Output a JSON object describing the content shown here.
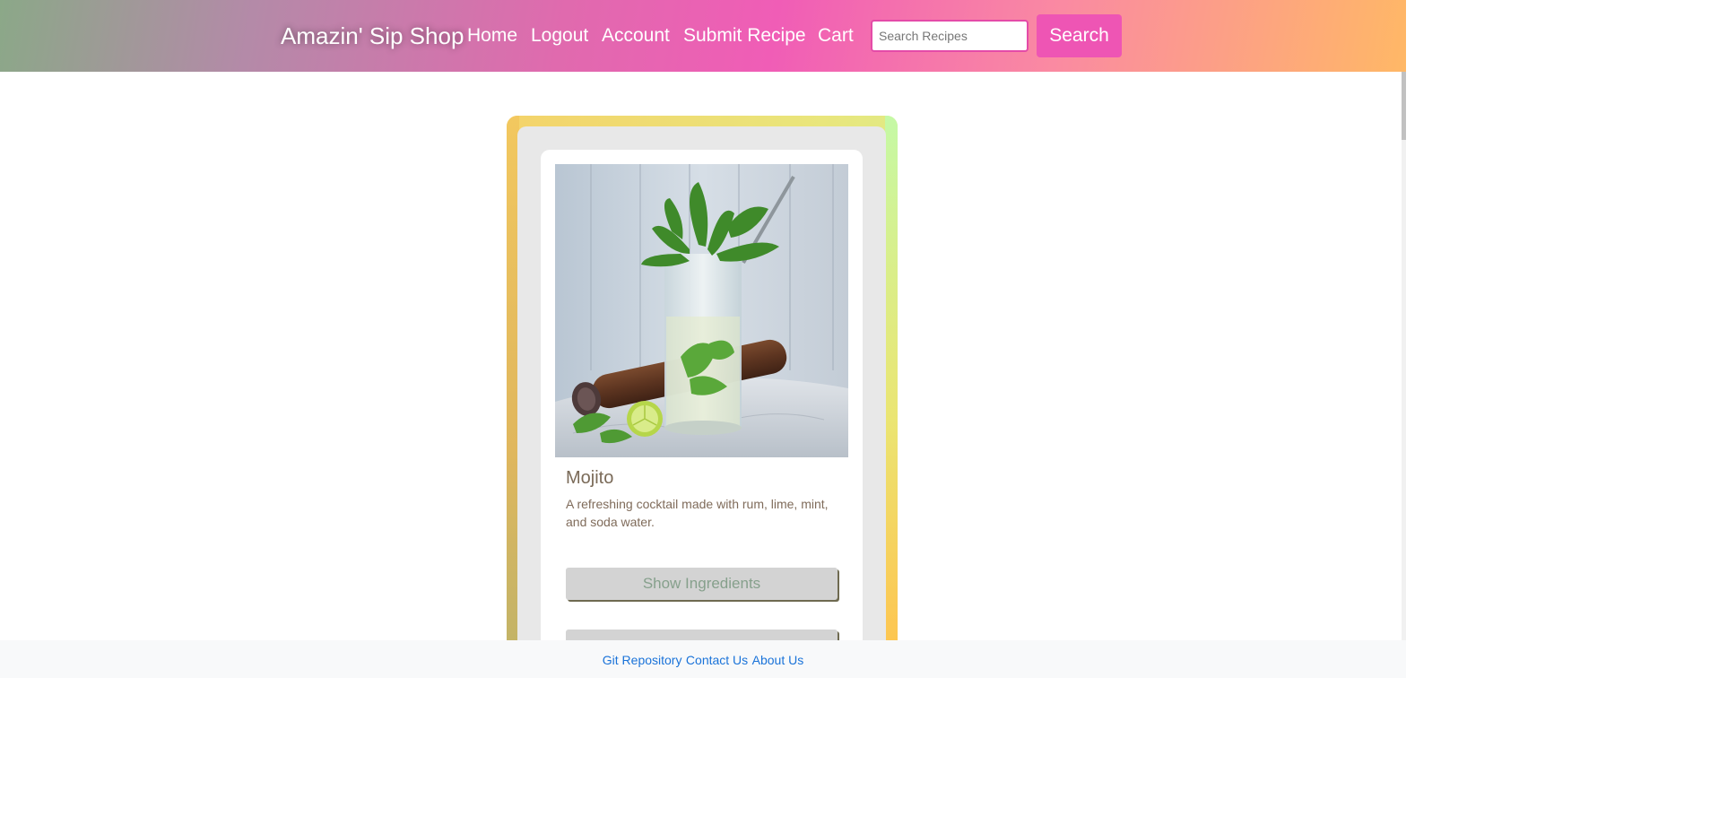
{
  "nav": {
    "brand": "Amazin' Sip Shop",
    "links": [
      "Home",
      "Logout",
      "Account",
      "Submit Recipe",
      "Cart"
    ],
    "search_placeholder": "Search Recipes",
    "search_button": "Search"
  },
  "recipe": {
    "title": "Mojito",
    "description": "A refreshing cocktail made with rum, lime, mint, and soda water.",
    "show_ingredients_label": "Show Ingredients"
  },
  "footer": {
    "links": [
      "Git Repository",
      "Contact Us",
      "About Us"
    ]
  },
  "colors": {
    "accent_pink": "#ee55b4",
    "footer_link": "#1a73d9"
  }
}
